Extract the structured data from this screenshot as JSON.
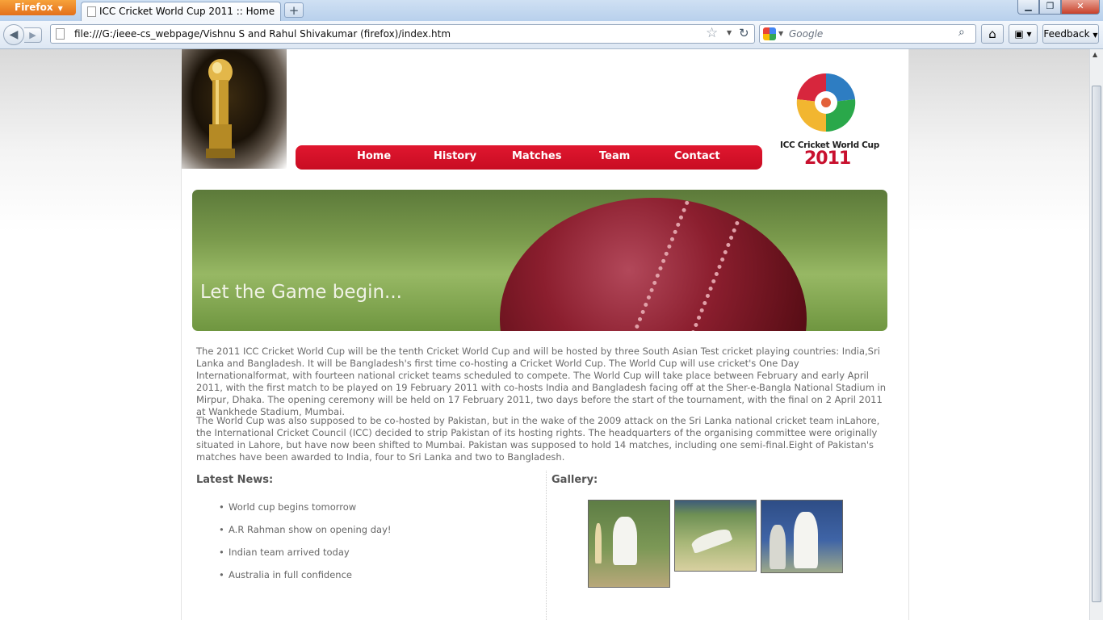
{
  "browser": {
    "menu_button": "Firefox",
    "tab_title": "ICC Cricket World Cup 2011 :: Home",
    "new_tab": "+",
    "url": "file:///G:/ieee-cs_webpage/Vishnu S and Rahul Shivakumar (firefox)/index.htm",
    "search_placeholder": "Google",
    "feedback_label": "Feedback"
  },
  "nav": {
    "items": [
      "Home",
      "History",
      "Matches",
      "Team",
      "Contact"
    ]
  },
  "logo": {
    "line1": "ICC Cricket World Cup",
    "line2": "2011"
  },
  "banner": {
    "tagline": "Let the Game begin..."
  },
  "content": {
    "paragraph1": "The 2011 ICC Cricket World Cup will be the tenth Cricket World Cup and will be hosted by three South Asian Test cricket playing countries: India,Sri Lanka and Bangladesh. It will be Bangladesh's first time co-hosting a Cricket World Cup. The World Cup will use cricket's One Day Internationalformat, with fourteen national cricket teams scheduled to compete. The World Cup will take place between February and early April 2011, with the first match to be played on 19 February 2011 with co-hosts India and Bangladesh facing off at the Sher-e-Bangla National Stadium in Mirpur, Dhaka. The opening ceremony will be held on 17 February 2011, two days before the start of the tournament, with the final on 2 April 2011 at Wankhede Stadium, Mumbai.",
    "paragraph2": "The World Cup was also supposed to be co-hosted by Pakistan, but in the wake of the 2009 attack on the Sri Lanka national cricket team inLahore, the International Cricket Council (ICC) decided to strip Pakistan of its hosting rights. The headquarters of the organising committee were originally situated in Lahore, but have now been shifted to Mumbai. Pakistan was supposed to hold 14 matches, including one semi-final.Eight of Pakistan's matches have been awarded to India, four to Sri Lanka and two to Bangladesh."
  },
  "news": {
    "heading": "Latest News:",
    "items": [
      "World cup begins tomorrow",
      "A.R Rahman show on opening day!",
      "Indian team arrived today",
      "Australia in full confidence"
    ]
  },
  "gallery": {
    "heading": "Gallery:"
  }
}
